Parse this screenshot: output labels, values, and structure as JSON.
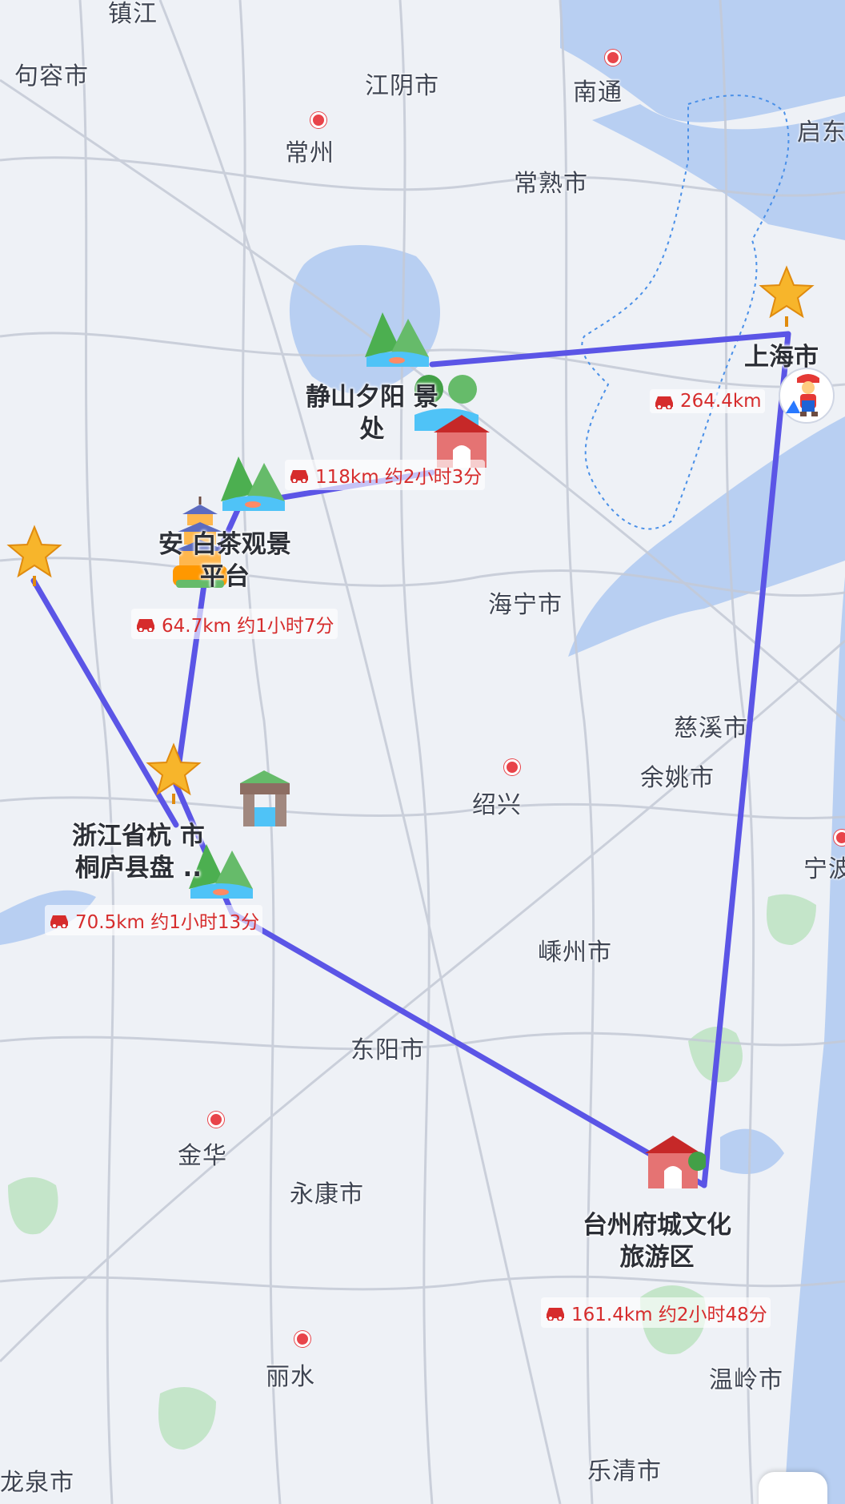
{
  "colors": {
    "water": "#b8cff2",
    "route": "#5b55e6",
    "distance_text": "#d62c2c",
    "road": "#c4cad6",
    "green": "#9bd3a4"
  },
  "cities": [
    {
      "id": "zhenjiang",
      "name": "镇江"
    },
    {
      "id": "jurong",
      "name": "句容市"
    },
    {
      "id": "jiangyin",
      "name": "江阴市"
    },
    {
      "id": "nantong",
      "name": "南通"
    },
    {
      "id": "qidong",
      "name": "启东"
    },
    {
      "id": "changzhou",
      "name": "常州"
    },
    {
      "id": "changshu",
      "name": "常熟市"
    },
    {
      "id": "haining",
      "name": "海宁市"
    },
    {
      "id": "cixi",
      "name": "慈溪市"
    },
    {
      "id": "yuyao",
      "name": "余姚市"
    },
    {
      "id": "shaoxing",
      "name": "绍兴"
    },
    {
      "id": "ningbo",
      "name": "宁波"
    },
    {
      "id": "shengzhou",
      "name": "嵊州市"
    },
    {
      "id": "dongyang",
      "name": "东阳市"
    },
    {
      "id": "jinhua",
      "name": "金华"
    },
    {
      "id": "yongkang",
      "name": "永康市"
    },
    {
      "id": "lishui",
      "name": "丽水"
    },
    {
      "id": "wenling",
      "name": "温岭市"
    },
    {
      "id": "longquan",
      "name": "龙泉市"
    },
    {
      "id": "yueqing",
      "name": "乐清市"
    }
  ],
  "pois": {
    "jingshan": {
      "label": "静山夕阳 景\n处",
      "distance": "118km 约2小时3分",
      "icon": "scenic-mountain-lake-icon"
    },
    "anji": {
      "label": "安 白茶观景\n平台",
      "distance": "64.7km 约1小时7分",
      "icon": "pagoda-icon"
    },
    "tonglu": {
      "label": "浙江省杭 市\n桐庐县盘 ..",
      "distance": "70.5km 约1小时13分",
      "icon": "stone-gate-icon"
    },
    "taizhou": {
      "label": "台州府城文化\n旅游区",
      "distance": "161.4km 约2小时48分",
      "icon": "city-gate-icon"
    },
    "shanghai": {
      "label": "上海市",
      "distance": "264.4km",
      "icon": "star-icon"
    }
  },
  "route": {
    "description": "Shanghai → Jingshan → Anji → Tonglu → Taizhou → Shanghai loop plus western branch",
    "stops": [
      "上海市",
      "静山夕阳 景处",
      "安 白茶观景平台",
      "浙江省杭 市桐庐县盘 ..",
      "台州府城文化旅游区"
    ]
  },
  "user_marker": {
    "icon": "mario-avatar-icon"
  }
}
